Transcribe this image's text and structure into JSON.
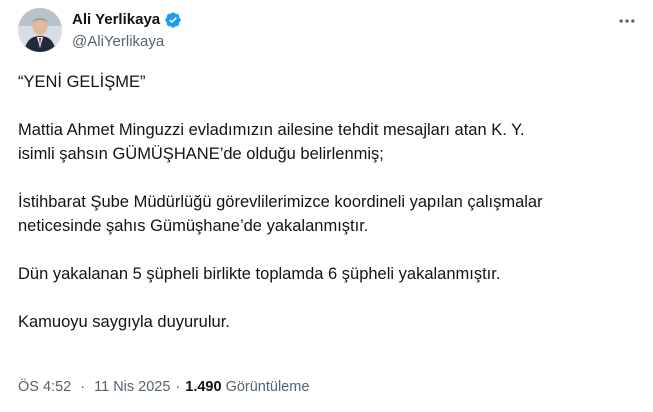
{
  "author": {
    "display_name": "Ali Yerlikaya",
    "handle": "@AliYerlikaya",
    "verified_icon": "verified-badge-icon"
  },
  "tweet": {
    "paragraphs": [
      "“YENİ GELİŞME”",
      "Mattia Ahmet Minguzzi evladımızın ailesine tehdit mesajları atan K. Y.\nisimli şahsın GÜMÜŞHANE’de olduğu belirlenmiş;",
      "İstihbarat Şube Müdürlüğü görevlilerimizce koordineli yapılan çalışmalar\nneticesinde şahıs Gümüşhane’de yakalanmıştır.",
      "Dün yakalanan 5 şüpheli birlikte toplamda 6 şüpheli yakalanmıştır.",
      "Kamuoyu saygıyla duyurulur."
    ]
  },
  "meta": {
    "time": "ÖS 4:52",
    "separator": "·",
    "date": "11 Nis 2025",
    "views_count": "1.490",
    "views_label": "Görüntüleme"
  },
  "colors": {
    "text": "#0f1419",
    "secondary": "#536471",
    "verified": "#1d9bf0"
  }
}
